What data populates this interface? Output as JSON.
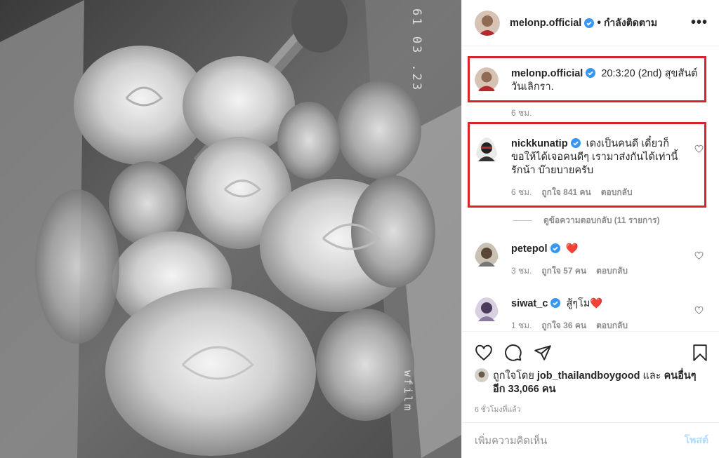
{
  "photo": {
    "film_date": "61 03 .23",
    "film_brand": "wfilm",
    "alt": "Bouquet of roses (black and white)"
  },
  "header": {
    "username": "melonp.official",
    "following_label": "กำลังติดตาม",
    "more_icon": "more-horizontal-icon"
  },
  "caption": {
    "username": "melonp.official",
    "text": "20:3:20 (2nd) สุขสันต์วันเลิกรา.",
    "time": "6 ชม."
  },
  "comments": [
    {
      "username": "nickkunatip",
      "verified": true,
      "text": "เดงเป็นคนดี เดี๋ยวก็ขอให้ได้เจอคนดีๆ เรามาส่งกันได้เท่านี้ รักน้า บ๊ายบายครับ",
      "time": "6 ชม.",
      "likes": "ถูกใจ 841 คน",
      "reply": "ตอบกลับ"
    },
    {
      "username": "petepol",
      "verified": true,
      "text": "❤️",
      "time": "3 ชม.",
      "likes": "ถูกใจ 57 คน",
      "reply": "ตอบกลับ"
    },
    {
      "username": "siwat_c",
      "verified": true,
      "text": "สู้ๆโม❤️",
      "time": "1 ชม.",
      "likes": "ถูกใจ 36 คน",
      "reply": "ตอบกลับ"
    }
  ],
  "view_replies": "ดูข้อความตอบกลับ (11 รายการ)",
  "liked_by": {
    "prefix": "ถูกใจโดย",
    "user": "job_thailandboygood",
    "and": "และ",
    "others": "คนอื่นๆ อีก 33,066 คน"
  },
  "time_ago": "6 ชั่วโมงที่แล้ว",
  "add_comment": {
    "placeholder": "เพิ่มความคิดเห็น",
    "post_label": "โพสต์"
  },
  "colors": {
    "verified": "#3897f0",
    "highlight": "#d9232b",
    "heart": "#ed4956",
    "muted": "#8e8e8e",
    "post_disabled": "#b3dbff"
  }
}
